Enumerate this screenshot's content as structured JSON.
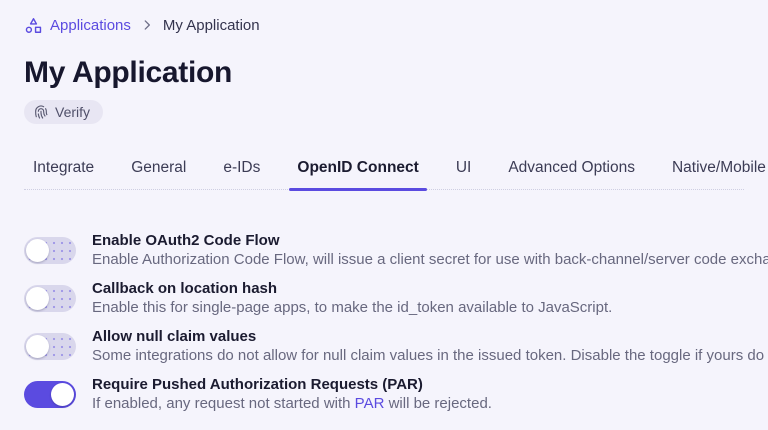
{
  "breadcrumb": {
    "root_label": "Applications",
    "current_label": "My Application"
  },
  "page": {
    "title": "My Application",
    "verify_label": "Verify"
  },
  "tabs": [
    {
      "label": "Integrate",
      "active": false
    },
    {
      "label": "General",
      "active": false
    },
    {
      "label": "e-IDs",
      "active": false
    },
    {
      "label": "OpenID Connect",
      "active": true
    },
    {
      "label": "UI",
      "active": false
    },
    {
      "label": "Advanced Options",
      "active": false
    },
    {
      "label": "Native/Mobile",
      "active": false
    }
  ],
  "settings": [
    {
      "label": "Enable OAuth2 Code Flow",
      "desc_prefix": "Enable Authorization Code Flow, will issue a client secret for use with back-channel/server code exchange.",
      "link_text": "",
      "desc_suffix": "",
      "enabled": false
    },
    {
      "label": "Callback on location hash",
      "desc_prefix": "Enable this for single-page apps, to make the id_token available to JavaScript.",
      "link_text": "",
      "desc_suffix": "",
      "enabled": false
    },
    {
      "label": "Allow null claim values",
      "desc_prefix": "Some integrations do not allow for null claim values in the issued token. Disable the toggle if yours do not.",
      "link_text": "",
      "desc_suffix": "",
      "enabled": false
    },
    {
      "label": "Require Pushed Authorization Requests (PAR)",
      "desc_prefix": "If enabled, any request not started with ",
      "link_text": "PAR",
      "desc_suffix": " will be rejected.",
      "enabled": true
    }
  ],
  "icons": {
    "breadcrumb_icon": "applications-hierarchy-icon",
    "badge_icon": "fingerprint-icon",
    "separator_icon": "chevron-right-icon"
  },
  "colors": {
    "accent_purple": "#5b4be0",
    "page_background": "#f5f4fc",
    "toggle_off_track": "#d9d7ec",
    "badge_background": "#e8e6f3",
    "title_text": "#17172e",
    "description_text": "#68687f"
  }
}
